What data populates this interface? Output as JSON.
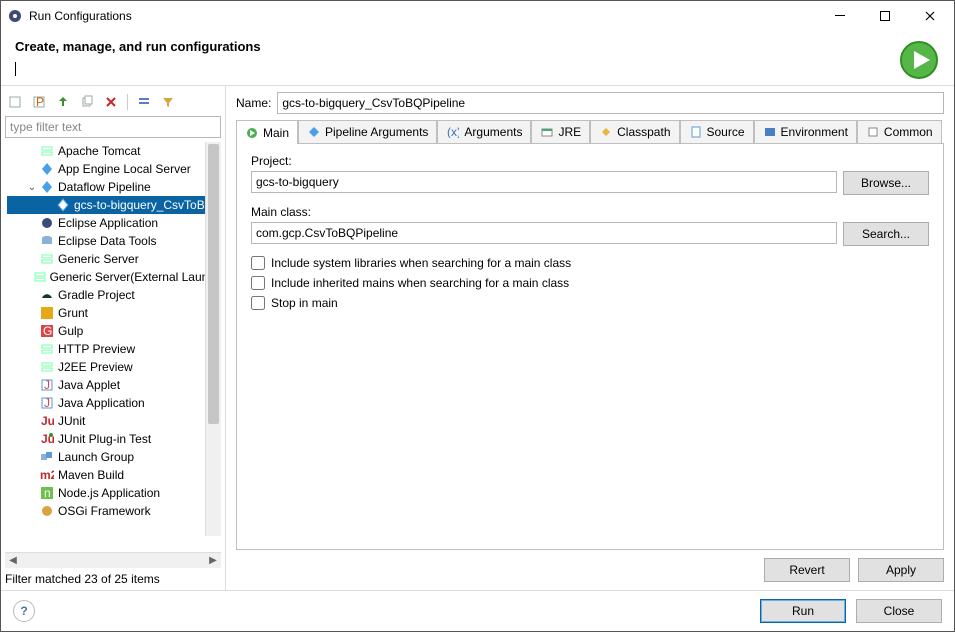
{
  "window": {
    "title": "Run Configurations"
  },
  "header": {
    "title": "Create, manage, and run configurations"
  },
  "filter": {
    "placeholder": "type filter text"
  },
  "tree": {
    "items": [
      {
        "label": "Apache Tomcat",
        "icon": "server"
      },
      {
        "label": "App Engine Local Server",
        "icon": "server-blue"
      },
      {
        "label": "Dataflow Pipeline",
        "icon": "dataflow",
        "expanded": true,
        "children": [
          {
            "label": "gcs-to-bigquery_CsvToBQ",
            "icon": "dataflow",
            "selected": true
          }
        ]
      },
      {
        "label": "Eclipse Application",
        "icon": "eclipse"
      },
      {
        "label": "Eclipse Data Tools",
        "icon": "datatools"
      },
      {
        "label": "Generic Server",
        "icon": "server"
      },
      {
        "label": "Generic Server(External Launch",
        "icon": "server"
      },
      {
        "label": "Gradle Project",
        "icon": "gradle"
      },
      {
        "label": "Grunt",
        "icon": "grunt"
      },
      {
        "label": "Gulp",
        "icon": "gulp"
      },
      {
        "label": "HTTP Preview",
        "icon": "server"
      },
      {
        "label": "J2EE Preview",
        "icon": "server"
      },
      {
        "label": "Java Applet",
        "icon": "java"
      },
      {
        "label": "Java Application",
        "icon": "java"
      },
      {
        "label": "JUnit",
        "icon": "junit"
      },
      {
        "label": "JUnit Plug-in Test",
        "icon": "junit-plugin"
      },
      {
        "label": "Launch Group",
        "icon": "launch-group"
      },
      {
        "label": "Maven Build",
        "icon": "maven"
      },
      {
        "label": "Node.js Application",
        "icon": "node"
      },
      {
        "label": "OSGi Framework",
        "icon": "osgi"
      }
    ]
  },
  "filterStatus": "Filter matched 23 of 25 items",
  "name": {
    "label": "Name:",
    "value": "gcs-to-bigquery_CsvToBQPipeline"
  },
  "tabs": {
    "main": "Main",
    "pipelineArgs": "Pipeline Arguments",
    "arguments": "Arguments",
    "jre": "JRE",
    "classpath": "Classpath",
    "source": "Source",
    "environment": "Environment",
    "common": "Common"
  },
  "main": {
    "projectLabel": "Project:",
    "projectValue": "gcs-to-bigquery",
    "browse": "Browse...",
    "mainClassLabel": "Main class:",
    "mainClassValue": "com.gcp.CsvToBQPipeline",
    "search": "Search...",
    "cbSystemLibs": "Include system libraries when searching for a main class",
    "cbInherited": "Include inherited mains when searching for a main class",
    "cbStop": "Stop in main"
  },
  "buttons": {
    "revert": "Revert",
    "apply": "Apply",
    "run": "Run",
    "close": "Close"
  }
}
